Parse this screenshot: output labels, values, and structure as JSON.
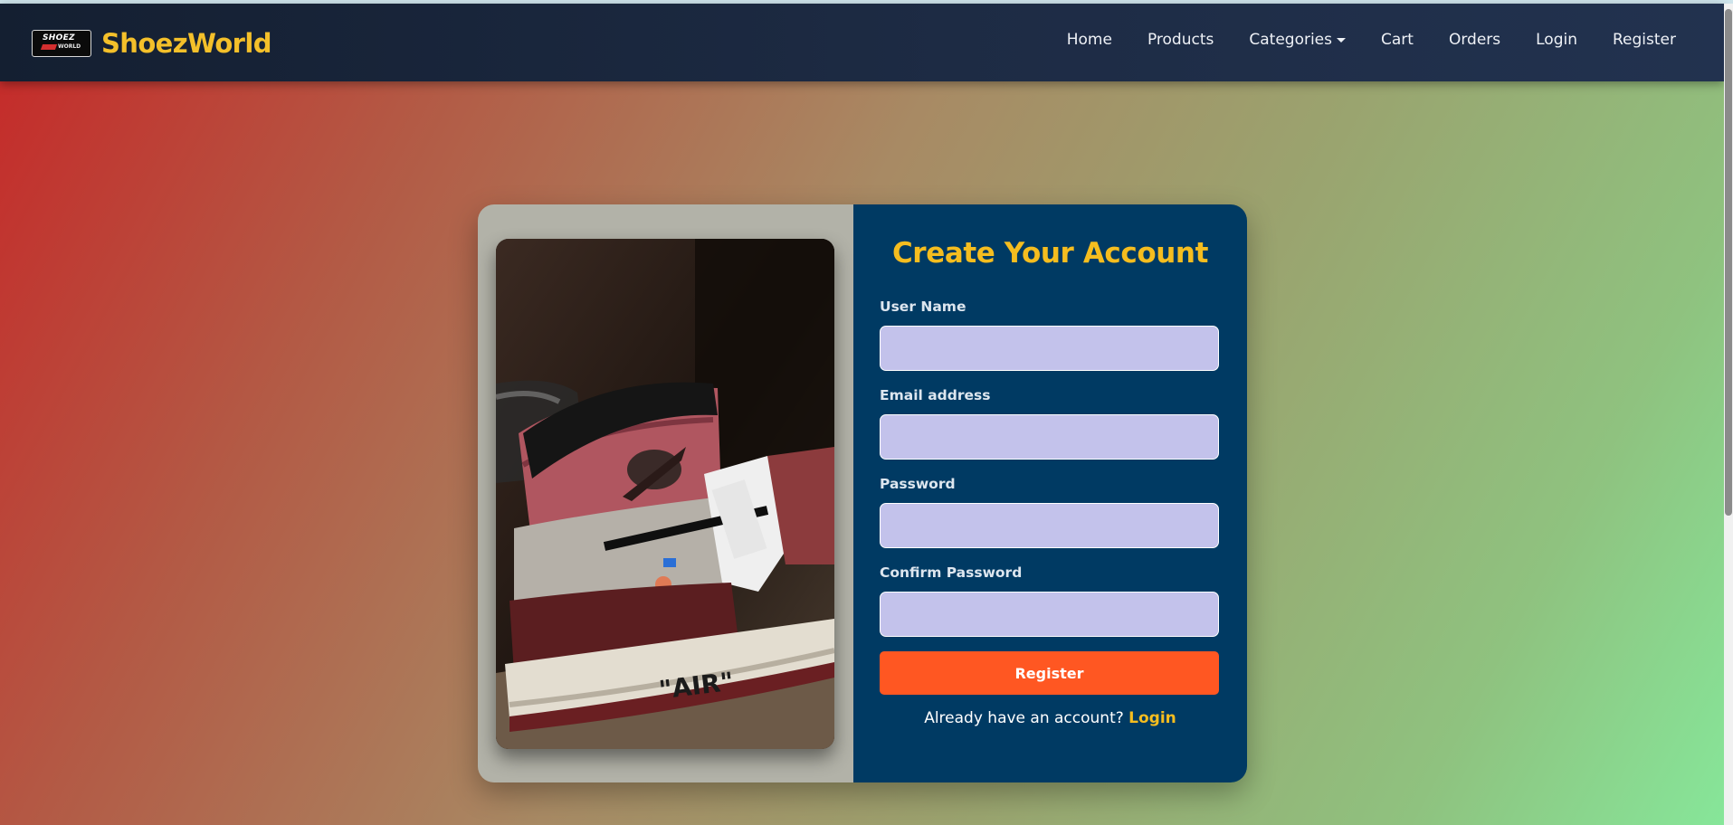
{
  "brand": {
    "name": "ShoezWorld",
    "logo_text_top": "SHOEZ",
    "logo_text_bottom": "WORLD",
    "color": "#f4c02a"
  },
  "nav": {
    "items": [
      {
        "label": "Home"
      },
      {
        "label": "Products"
      },
      {
        "label": "Categories",
        "dropdown": true
      },
      {
        "label": "Cart"
      },
      {
        "label": "Orders"
      },
      {
        "label": "Login"
      },
      {
        "label": "Register"
      }
    ]
  },
  "image": {
    "subject": "sneaker-photo",
    "shoe_text": "\"AIR\""
  },
  "form": {
    "title": "Create Your Account",
    "fields": {
      "username": {
        "label": "User Name",
        "value": ""
      },
      "email": {
        "label": "Email address",
        "value": ""
      },
      "password": {
        "label": "Password",
        "value": ""
      },
      "confirm_password": {
        "label": "Confirm Password",
        "value": ""
      }
    },
    "submit_label": "Register",
    "footer_text": "Already have an account?",
    "login_link": "Login"
  },
  "colors": {
    "accent": "#f5bd1f",
    "panel": "#003a63",
    "button": "#ff5722",
    "input_bg": "#c3c2eb",
    "navbar": "#1d2b44"
  }
}
